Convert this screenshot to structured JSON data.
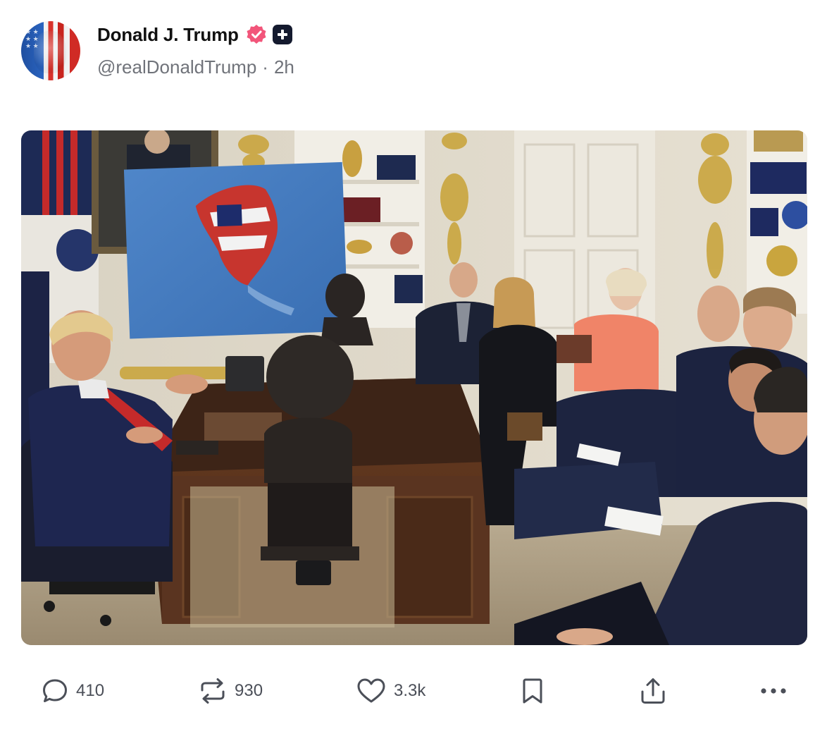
{
  "post": {
    "author": {
      "display_name": "Donald J. Trump",
      "handle": "@realDonaldTrump",
      "separator": "·",
      "time_ago": "2h",
      "verified_icon": "verified-badge-icon",
      "badge_icon": "plus-badge-icon",
      "avatar_icon": "flag-portrait-avatar"
    },
    "media": {
      "type": "photo",
      "icon": "meeting-photo"
    },
    "actions": {
      "reply": {
        "icon": "comment-icon",
        "count": "410"
      },
      "repost": {
        "icon": "repost-icon",
        "count": "930"
      },
      "like": {
        "icon": "heart-icon",
        "count": "3.3k"
      },
      "bookmark": {
        "icon": "bookmark-icon"
      },
      "share": {
        "icon": "share-icon"
      },
      "more": {
        "icon": "more-icon"
      }
    }
  },
  "colors": {
    "verified": "#f2557a",
    "badge_bg": "#141a2e",
    "text_primary": "#111111",
    "text_secondary": "#70737a",
    "icon": "#4b4f58"
  }
}
